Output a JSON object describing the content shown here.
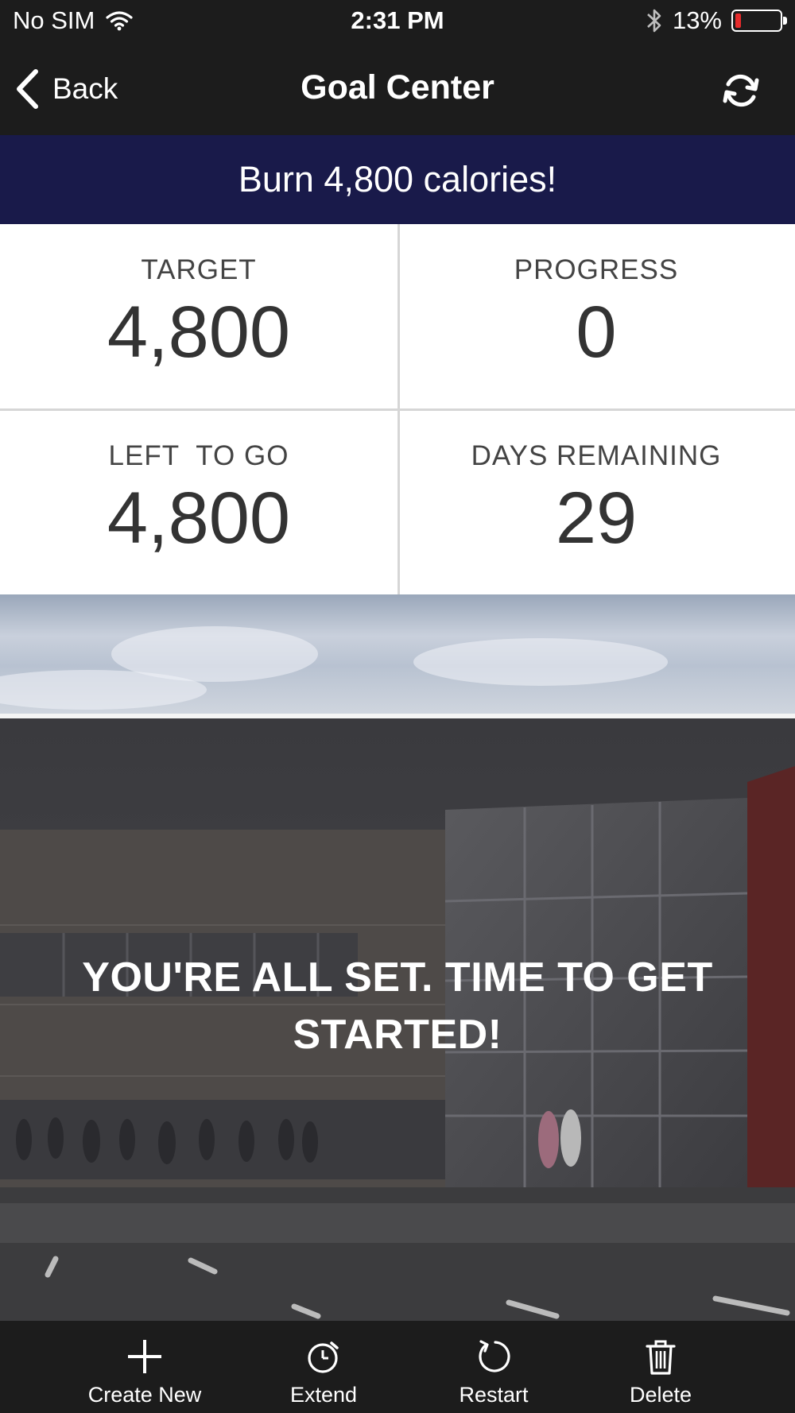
{
  "status_bar": {
    "carrier": "No SIM",
    "time": "2:31 PM",
    "battery_percent": "13%",
    "battery_level": 0.13,
    "icons": [
      "wifi-icon",
      "bluetooth-icon",
      "battery-icon"
    ]
  },
  "nav": {
    "back_label": "Back",
    "title": "Goal Center",
    "refresh_icon": "refresh-icon"
  },
  "goal": {
    "banner": "Burn 4,800 calories!"
  },
  "stats": {
    "target_label": "TARGET",
    "target_value": "4,800",
    "progress_label": "PROGRESS",
    "progress_value": "0",
    "left_label": "LEFT  TO GO",
    "left_value": "4,800",
    "days_label": "DAYS REMAINING",
    "days_value": "29"
  },
  "hero": {
    "message": "YOU'RE ALL SET. TIME TO GET STARTED!"
  },
  "tab_bar": {
    "items": [
      {
        "label": "Create New",
        "icon": "plus-icon"
      },
      {
        "label": "Extend",
        "icon": "stopwatch-icon"
      },
      {
        "label": "Restart",
        "icon": "restart-icon"
      },
      {
        "label": "Delete",
        "icon": "trash-icon"
      }
    ]
  },
  "colors": {
    "bar_background": "#1c1c1c",
    "banner_background": "#191a4a",
    "battery_low": "#e52b2b"
  }
}
